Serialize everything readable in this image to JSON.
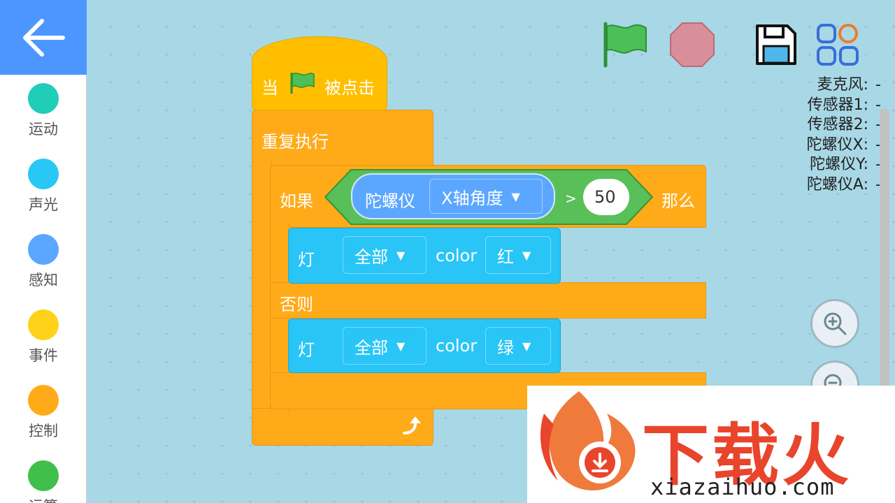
{
  "sidebar": {
    "back_icon": "arrow-left-icon",
    "categories": [
      {
        "label": "运动",
        "color": "#1fcdb9"
      },
      {
        "label": "声光",
        "color": "#28c7f6"
      },
      {
        "label": "感知",
        "color": "#5ba7ff"
      },
      {
        "label": "事件",
        "color": "#ffd21a"
      },
      {
        "label": "控制",
        "color": "#ffab19"
      },
      {
        "label": "运算",
        "color": "#40bf4a"
      }
    ]
  },
  "toolbar": {
    "run_icon": "green-flag-icon",
    "stop_icon": "stop-icon",
    "save_icon": "save-icon",
    "apps_icon": "apps-grid-icon"
  },
  "sensors": [
    {
      "label": "麦克风:",
      "value": "-"
    },
    {
      "label": "传感器1:",
      "value": "-"
    },
    {
      "label": "传感器2:",
      "value": "-"
    },
    {
      "label": "陀螺仪X:",
      "value": "-"
    },
    {
      "label": "陀螺仪Y:",
      "value": "-"
    },
    {
      "label": "陀螺仪A:",
      "value": "-"
    }
  ],
  "blocks": {
    "hat_when": "当",
    "hat_clicked": "被点击",
    "repeat": "重复执行",
    "if": "如果",
    "gyro": "陀螺仪",
    "gyro_axis": "X轴角度",
    "gt": ">",
    "threshold": "50",
    "then": "那么",
    "light1": "灯",
    "light1_target": "全部",
    "light1_color_word": "color",
    "light1_color": "红",
    "else": "否则",
    "light2": "灯",
    "light2_target": "全部",
    "light2_color_word": "color",
    "light2_color": "绿"
  },
  "watermark": {
    "brand": "下载火",
    "url": "xiazaihuo.com"
  },
  "colors": {
    "accent": "#4c97ff",
    "workspace": "#a8d8e6",
    "control": "#ffab19",
    "event": "#ffbf00",
    "looks": "#29c5f6",
    "operator": "#59c059"
  }
}
